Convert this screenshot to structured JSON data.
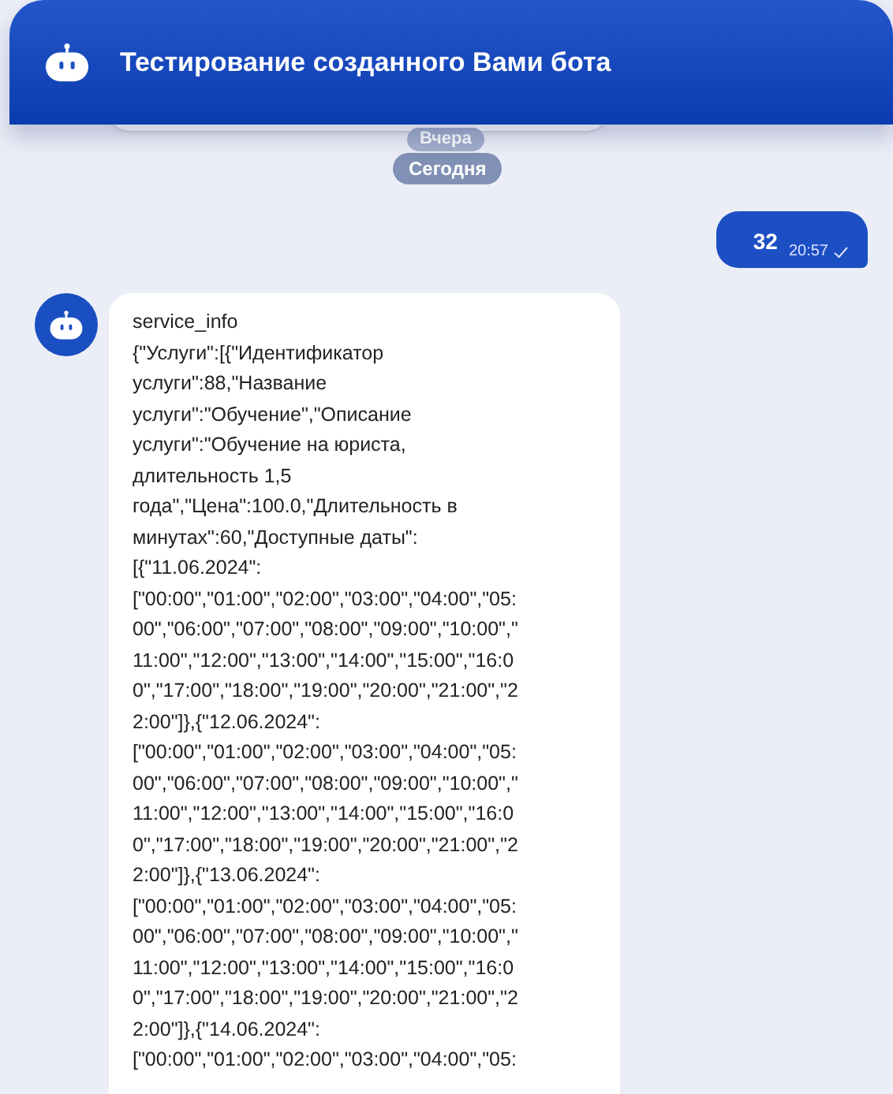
{
  "header": {
    "title": "Тестирование созданного Вами бота"
  },
  "date_dividers": [
    {
      "label": "Вчера",
      "kind": "scrolled"
    },
    {
      "label": "Сегодня",
      "kind": "current"
    }
  ],
  "messages": [
    {
      "kind": "outgoing",
      "text": "32",
      "time": "20:57",
      "delivered": true
    },
    {
      "kind": "incoming",
      "text": "service_info\n{\"Услуги\":[{\"Идентификатор\nуслуги\":88,\"Название\nуслуги\":\"Обучение\",\"Описание\nуслуги\":\"Обучение на юриста,\nдлительность 1,5\nгода\",\"Цена\":100.0,\"Длительность в\nминутах\":60,\"Доступные даты\":\n[{\"11.06.2024\":\n[\"00:00\",\"01:00\",\"02:00\",\"03:00\",\"04:00\",\"05:\n00\",\"06:00\",\"07:00\",\"08:00\",\"09:00\",\"10:00\",\"\n11:00\",\"12:00\",\"13:00\",\"14:00\",\"15:00\",\"16:0\n0\",\"17:00\",\"18:00\",\"19:00\",\"20:00\",\"21:00\",\"2\n2:00\"]},{\"12.06.2024\":\n[\"00:00\",\"01:00\",\"02:00\",\"03:00\",\"04:00\",\"05:\n00\",\"06:00\",\"07:00\",\"08:00\",\"09:00\",\"10:00\",\"\n11:00\",\"12:00\",\"13:00\",\"14:00\",\"15:00\",\"16:0\n0\",\"17:00\",\"18:00\",\"19:00\",\"20:00\",\"21:00\",\"2\n2:00\"]},{\"13.06.2024\":\n[\"00:00\",\"01:00\",\"02:00\",\"03:00\",\"04:00\",\"05:\n00\",\"06:00\",\"07:00\",\"08:00\",\"09:00\",\"10:00\",\"\n11:00\",\"12:00\",\"13:00\",\"14:00\",\"15:00\",\"16:0\n0\",\"17:00\",\"18:00\",\"19:00\",\"20:00\",\"21:00\",\"2\n2:00\"]},{\"14.06.2024\":\n[\"00:00\",\"01:00\",\"02:00\",\"03:00\",\"04:00\",\"05:"
    }
  ]
}
